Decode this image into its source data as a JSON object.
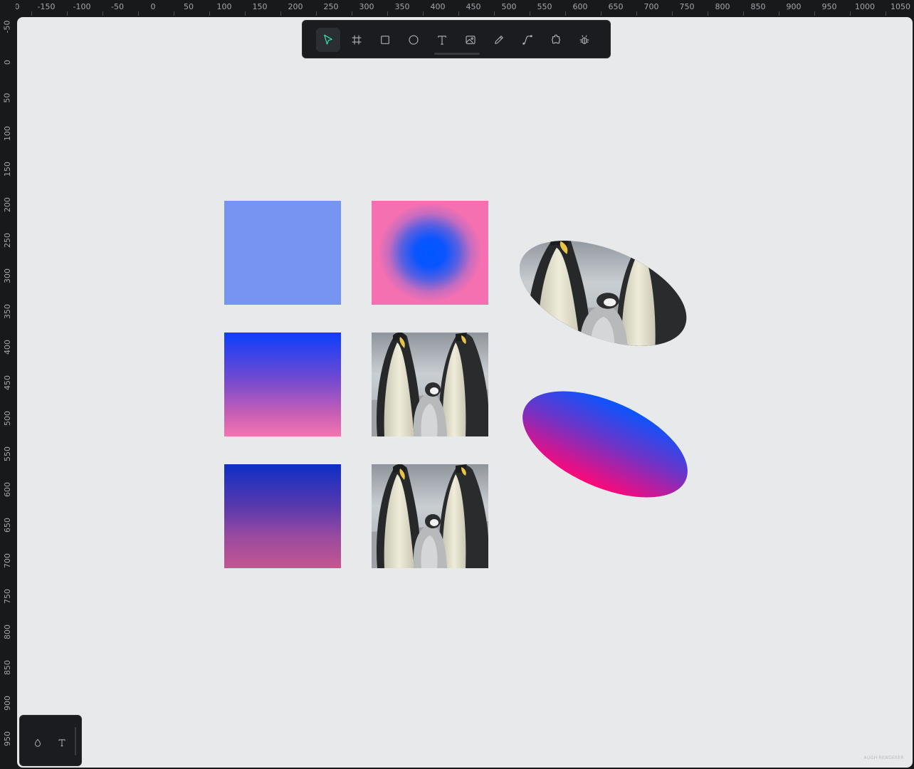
{
  "rulers": {
    "horizontal_ticks": [
      "0",
      "-150",
      "-100",
      "-50",
      "0",
      "50",
      "100",
      "150",
      "200",
      "250",
      "300",
      "350",
      "400",
      "450",
      "500",
      "550",
      "600",
      "650",
      "700",
      "750",
      "800",
      "850",
      "900",
      "950",
      "1000",
      "1050"
    ],
    "vertical_ticks": [
      "-50",
      "0",
      "50",
      "100",
      "150",
      "200",
      "250",
      "300",
      "350",
      "400",
      "450",
      "500",
      "550",
      "600",
      "650",
      "700",
      "750",
      "800",
      "850",
      "900",
      "950"
    ]
  },
  "toolbar": {
    "tools": [
      {
        "id": "move",
        "icon": "pointer-icon",
        "active": true
      },
      {
        "id": "board",
        "icon": "board-icon",
        "active": false
      },
      {
        "id": "rectangle",
        "icon": "rectangle-icon",
        "active": false
      },
      {
        "id": "ellipse",
        "icon": "ellipse-icon",
        "active": false
      },
      {
        "id": "text",
        "icon": "text-icon",
        "active": false
      },
      {
        "id": "image",
        "icon": "image-icon",
        "active": false
      },
      {
        "id": "pencil",
        "icon": "pencil-icon",
        "active": false
      },
      {
        "id": "path",
        "icon": "path-icon",
        "active": false
      },
      {
        "id": "plugins",
        "icon": "puzzle-icon",
        "active": false
      },
      {
        "id": "debug",
        "icon": "bug-icon",
        "active": false
      }
    ]
  },
  "canvas": {
    "background": "#e8e9eb",
    "shapes": [
      {
        "id": "rect-flat",
        "fill": "#7695f2"
      },
      {
        "id": "rect-radial",
        "fill": "radial #0057ff to #f570b1"
      },
      {
        "id": "rect-linear-1",
        "fill": "linear #0b3ffc to #f374b0"
      },
      {
        "id": "rect-linear-2",
        "fill": "linear #0d2fc6 to #c4568f"
      },
      {
        "id": "image-penguins-1",
        "fill": "image"
      },
      {
        "id": "image-penguins-2",
        "fill": "image"
      },
      {
        "id": "ellipse-penguins",
        "fill": "image"
      },
      {
        "id": "ellipse-gradient",
        "fill": "linear #0a55ff to #ff0878"
      }
    ]
  },
  "bottom_palette": {
    "buttons": [
      {
        "id": "color-palette",
        "icon": "droplet-icon"
      },
      {
        "id": "text-palette",
        "icon": "text-icon"
      }
    ]
  },
  "watermark": "AUGH RENDERER"
}
